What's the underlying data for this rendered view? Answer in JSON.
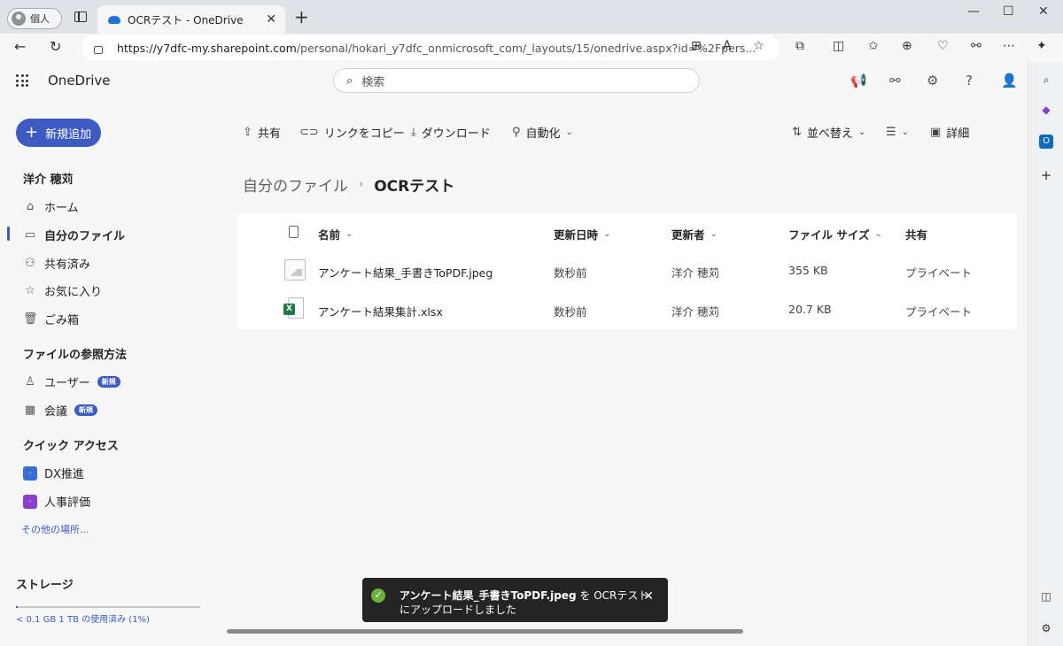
{
  "browser": {
    "profile_label": "個人",
    "tab_title": "OCRテスト - OneDrive",
    "url_main": "https://y7dfc-my.sharepoint.com",
    "url_rest": "/personal/hokari_y7dfc_onmicrosoft_com/_layouts/15/onedrive.aspx?id=%2Fpers..."
  },
  "app": {
    "brand": "OneDrive",
    "search_placeholder": "検索"
  },
  "sidebar": {
    "new_button": "新規追加",
    "user_name": "洋介 穂苅",
    "items": [
      {
        "label": "ホーム"
      },
      {
        "label": "自分のファイル"
      },
      {
        "label": "共有済み"
      },
      {
        "label": "お気に入り"
      },
      {
        "label": "ごみ箱"
      }
    ],
    "browse_heading": "ファイルの参照方法",
    "browse_items": [
      {
        "label": "ユーザー",
        "badge": "新規"
      },
      {
        "label": "会議",
        "badge": "新規"
      }
    ],
    "quick_heading": "クイック アクセス",
    "quick_items": [
      {
        "label": "DX推進",
        "color": "#3b6fd6"
      },
      {
        "label": "人事評価",
        "color": "#8a3fd1"
      }
    ],
    "more_link": "その他の場所...",
    "storage_heading": "ストレージ",
    "storage_text": "< 0.1 GB 1 TB の使用済み (1%)",
    "storage_used_percent": 1
  },
  "commands": {
    "share": "共有",
    "copy_link": "リンクをコピー",
    "download": "ダウンロード",
    "automate": "自動化",
    "sort": "並べ替え",
    "details": "詳細"
  },
  "breadcrumb": {
    "parent": "自分のファイル",
    "current": "OCRテスト"
  },
  "table": {
    "columns": {
      "name": "名前",
      "modified": "更新日時",
      "modified_by": "更新者",
      "size": "ファイル サイズ",
      "sharing": "共有"
    },
    "rows": [
      {
        "name": "アンケート結果_手書きToPDF.jpeg",
        "modified": "数秒前",
        "modified_by": "洋介 穂苅",
        "size": "355 KB",
        "sharing": "プライベート",
        "type": "image"
      },
      {
        "name": "アンケート結果集計.xlsx",
        "modified": "数秒前",
        "modified_by": "洋介 穂苅",
        "size": "20.7 KB",
        "sharing": "プライベート",
        "type": "excel"
      }
    ]
  },
  "toast": {
    "file": "アンケート結果_手書きToPDF.jpeg",
    "line1_suffix": "を OCRテスト",
    "line2": "にアップロードしました"
  },
  "colors": {
    "accent": "#3e5bc4",
    "excel": "#1d7a45",
    "success": "#6bb33a"
  }
}
